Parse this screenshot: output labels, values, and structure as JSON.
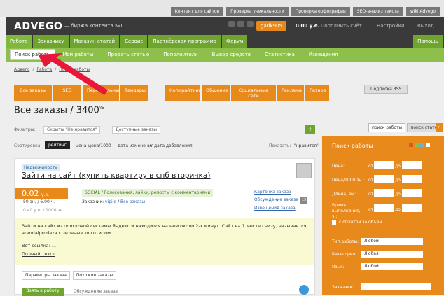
{
  "toplinks": [
    "Контент для сайтов",
    "Проверка уникальности",
    "Проверка орфографии",
    "SEO-анализ текста",
    "wiki.Advego"
  ],
  "header": {
    "logo": "ADVEGO",
    "tagline": "— биржа контента №1",
    "user": "garik905",
    "balance": "0.00 у.е.",
    "topup": "Пополнить счёт",
    "settings": "Настройки",
    "logout": "Выход"
  },
  "nav": {
    "tabs": [
      "Работа",
      "Заказчику",
      "Магазин статей",
      "Сервис",
      "Партнёрская программа",
      "Форум"
    ],
    "help": "Помощь"
  },
  "subnav": [
    "Поиск работы",
    "Мои работы",
    "Продать статью",
    "Пополнители",
    "Вывод средств",
    "Статистика",
    "Извещения"
  ],
  "breadcrumb": [
    "Адвего",
    "Работа",
    "Поиск работы"
  ],
  "filters": [
    "Все заказы",
    "SEO",
    "Персональные",
    "Тендеры",
    "Копирайтинг",
    "Общение",
    "Социальные сети",
    "Реклама",
    "Разное"
  ],
  "rss": "Подписка RSS",
  "page_title": "Все заказы / 3400",
  "page_title_sup": "%",
  "filter_row": {
    "label": "Фильтры:",
    "chip1": "Скрыты \"Не нравится\"",
    "chip2": "Доступные заказы"
  },
  "sort": {
    "label": "Сортировка:",
    "rating": "рейтинг",
    "items": [
      "цена",
      "цена/1000",
      "дата изменения",
      "дата добавления"
    ],
    "show_label": "Показать:",
    "show_value": "\"нравится\""
  },
  "order": {
    "tag": "Недвижимость",
    "title": "Зайти на сайт (купить квартиру в спб вторичка)",
    "price": "0.02",
    "price_unit": "у.е.",
    "chars": "50 зн. / 6.00 ч.",
    "per": "0.40 у.е. / 1000 зн.",
    "category": "SOCIAL / Голосования, лайки, репосты с комментариями",
    "customer_label": "Заказчик:",
    "customer": "vipild",
    "all": "Все заказы",
    "link1": "Карточка заказа",
    "link2": "Обсуждение заказа",
    "link2_badge": "15",
    "link3": "Извещения заказа",
    "description": "Зайти на сайт из поисковой системы Яндекс и находится на нем около 2-х минут. Сайт на 1 месте снизу, называется arendalprodaza с зеленым логотипом.",
    "link_label": "Вот ссылка:",
    "full": "Полный текст",
    "tab1": "Параметры заказа",
    "tab2": "Похожие заказы",
    "take": "Взять в работу",
    "bottom": "Обсуждение заказа"
  },
  "side": {
    "tab1": "поиск работы",
    "tab2": "поиск статей",
    "panel_title": "Поиск работы",
    "price": "Цена:",
    "price1000": "Цена/1000 зн.:",
    "length": "Длина, зн.:",
    "time": "Время выполнения, ч.:",
    "from": "от",
    "to": "до",
    "checkbox": "с оплатой за объем",
    "type_label": "Тип работы:",
    "type": "Любой",
    "cat_label": "Категория:",
    "cat": "Любая",
    "lang_label": "Язык:",
    "lang": "Любой",
    "order_label": "Заказчик:"
  },
  "colors": {
    "green": "#6fa52e",
    "orange": "#e8891c",
    "dark": "#3a3a3a",
    "arrow": "#e8173a"
  }
}
